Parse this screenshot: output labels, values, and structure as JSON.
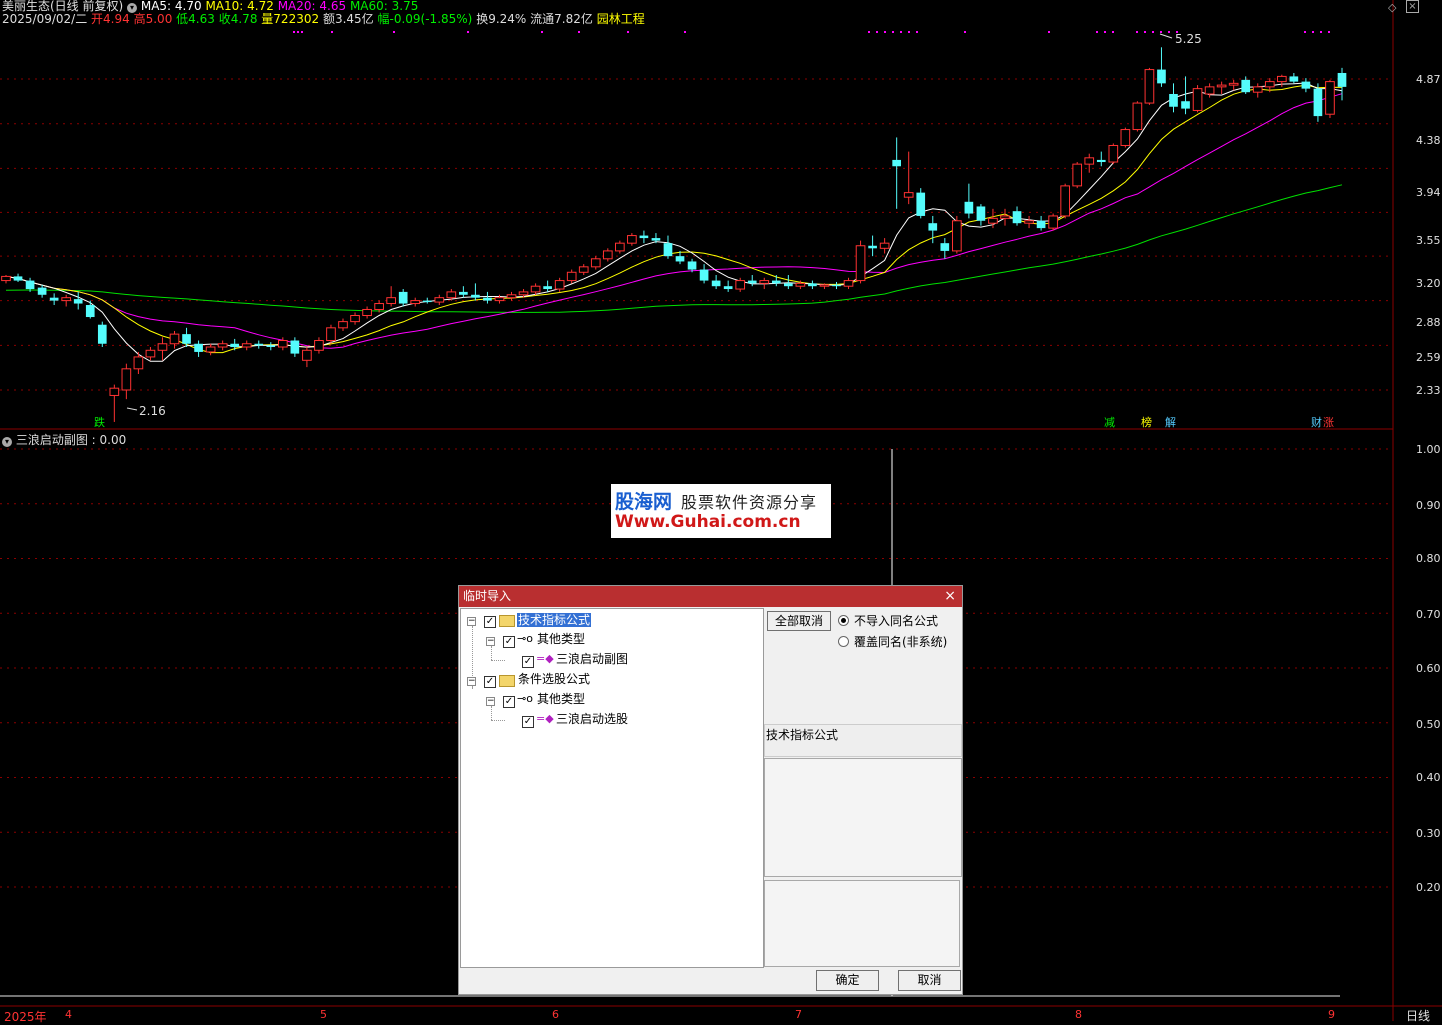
{
  "chart_header": {
    "stock": "美丽生态(日线 前复权)",
    "ma5": "MA5: 4.70",
    "ma10": "MA10: 4.72",
    "ma20": "MA20: 4.65",
    "ma60": "MA60: 3.75",
    "date": "2025/09/02/二",
    "open": "开4.94",
    "high": "高5.00",
    "low": "低4.63",
    "close": "收4.78",
    "volume": "量722302",
    "amount": "额3.45亿",
    "change": "幅-0.09(-1.85%)",
    "turnover": "换9.24%",
    "float_cap": "流通7.82亿",
    "sector": "园林工程"
  },
  "colors": {
    "up": "#ff3232",
    "down": "#54fcfc",
    "ma5": "#ffffff",
    "ma10": "#ffff00",
    "ma20": "#ff00ff",
    "ma60": "#00e000",
    "grid": "#8b0000"
  },
  "price_axis": [
    "4.87",
    "4.38",
    "3.94",
    "3.55",
    "3.20",
    "2.88",
    "2.59",
    "2.33"
  ],
  "indicator_axis": [
    "1.00",
    "0.90",
    "0.80",
    "0.70",
    "0.60",
    "0.50",
    "0.40",
    "0.30",
    "0.20"
  ],
  "time_axis": [
    "2025年",
    "4",
    "5",
    "6",
    "7",
    "8",
    "9"
  ],
  "period_label": "日线",
  "annotations": {
    "high_mark": "5.25",
    "low_mark": "2.16"
  },
  "event_marks": [
    "跌",
    "减",
    "榜",
    "解",
    "财",
    "涨"
  ],
  "sub_chart": {
    "title": "三浪启动副图 : 0.00"
  },
  "watermark": {
    "brand": "股海网",
    "slogan": "股票软件资源分享",
    "url": "Www.Guhai.com.cn"
  },
  "dialog": {
    "title": "临时导入",
    "close_icon": "×",
    "tree": [
      {
        "label": "技术指标公式"
      },
      {
        "label": "其他类型"
      },
      {
        "label": "三浪启动副图"
      },
      {
        "label": "条件选股公式"
      },
      {
        "label": "其他类型"
      },
      {
        "label": "三浪启动选股"
      }
    ],
    "btn_uncheck_all": "全部取消",
    "radio_no_import": "不导入同名公式",
    "radio_overwrite": "覆盖同名(非系统)",
    "info_label": "技术指标公式",
    "btn_ok": "确定",
    "btn_cancel": "取消"
  },
  "chart_data": {
    "type": "candlestick",
    "ylim": [
      2.16,
      5.25
    ],
    "candles": [
      [
        3.02,
        3.06,
        3.0,
        3.05
      ],
      [
        3.05,
        3.07,
        3.01,
        3.02
      ],
      [
        3.02,
        3.04,
        2.94,
        2.96
      ],
      [
        2.97,
        2.99,
        2.9,
        2.92
      ],
      [
        2.9,
        2.93,
        2.85,
        2.88
      ],
      [
        2.88,
        2.92,
        2.84,
        2.9
      ],
      [
        2.89,
        2.94,
        2.82,
        2.86
      ],
      [
        2.85,
        2.88,
        2.76,
        2.77
      ],
      [
        2.72,
        2.74,
        2.58,
        2.6
      ],
      [
        2.3,
        2.36,
        2.16,
        2.34
      ],
      [
        2.33,
        2.48,
        2.28,
        2.45
      ],
      [
        2.45,
        2.55,
        2.42,
        2.52
      ],
      [
        2.52,
        2.58,
        2.5,
        2.56
      ],
      [
        2.56,
        2.64,
        2.5,
        2.6
      ],
      [
        2.6,
        2.68,
        2.57,
        2.66
      ],
      [
        2.66,
        2.7,
        2.58,
        2.6
      ],
      [
        2.6,
        2.62,
        2.52,
        2.55
      ],
      [
        2.55,
        2.6,
        2.53,
        2.58
      ],
      [
        2.58,
        2.62,
        2.56,
        2.6
      ],
      [
        2.6,
        2.63,
        2.56,
        2.58
      ],
      [
        2.58,
        2.62,
        2.56,
        2.6
      ],
      [
        2.6,
        2.62,
        2.57,
        2.59
      ],
      [
        2.59,
        2.61,
        2.56,
        2.58
      ],
      [
        2.58,
        2.64,
        2.56,
        2.62
      ],
      [
        2.62,
        2.64,
        2.52,
        2.54
      ],
      [
        2.5,
        2.58,
        2.46,
        2.56
      ],
      [
        2.56,
        2.64,
        2.54,
        2.62
      ],
      [
        2.62,
        2.72,
        2.6,
        2.7
      ],
      [
        2.7,
        2.76,
        2.68,
        2.74
      ],
      [
        2.74,
        2.8,
        2.72,
        2.78
      ],
      [
        2.78,
        2.84,
        2.76,
        2.82
      ],
      [
        2.82,
        2.88,
        2.8,
        2.86
      ],
      [
        2.86,
        2.98,
        2.84,
        2.9
      ],
      [
        2.94,
        2.96,
        2.84,
        2.86
      ],
      [
        2.86,
        2.9,
        2.84,
        2.88
      ],
      [
        2.88,
        2.9,
        2.86,
        2.87
      ],
      [
        2.87,
        2.92,
        2.85,
        2.9
      ],
      [
        2.9,
        2.96,
        2.88,
        2.94
      ],
      [
        2.94,
        2.98,
        2.9,
        2.92
      ],
      [
        2.92,
        3.0,
        2.88,
        2.9
      ],
      [
        2.9,
        2.94,
        2.86,
        2.88
      ],
      [
        2.88,
        2.92,
        2.86,
        2.9
      ],
      [
        2.9,
        2.94,
        2.88,
        2.92
      ],
      [
        2.92,
        2.96,
        2.9,
        2.94
      ],
      [
        2.94,
        3.0,
        2.92,
        2.98
      ],
      [
        2.98,
        3.02,
        2.94,
        2.96
      ],
      [
        2.96,
        3.04,
        2.94,
        3.02
      ],
      [
        3.02,
        3.1,
        3.0,
        3.08
      ],
      [
        3.08,
        3.14,
        3.06,
        3.12
      ],
      [
        3.12,
        3.2,
        3.1,
        3.18
      ],
      [
        3.18,
        3.26,
        3.16,
        3.24
      ],
      [
        3.24,
        3.32,
        3.22,
        3.3
      ],
      [
        3.3,
        3.38,
        3.28,
        3.36
      ],
      [
        3.36,
        3.4,
        3.3,
        3.34
      ],
      [
        3.34,
        3.38,
        3.3,
        3.32
      ],
      [
        3.3,
        3.36,
        3.18,
        3.2
      ],
      [
        3.2,
        3.24,
        3.14,
        3.16
      ],
      [
        3.16,
        3.18,
        3.08,
        3.1
      ],
      [
        3.1,
        3.14,
        3.0,
        3.02
      ],
      [
        3.02,
        3.06,
        2.96,
        2.98
      ],
      [
        2.98,
        3.02,
        2.94,
        2.96
      ],
      [
        2.96,
        3.04,
        2.94,
        3.02
      ],
      [
        3.02,
        3.06,
        2.98,
        3.0
      ],
      [
        3.0,
        3.04,
        2.96,
        3.02
      ],
      [
        3.02,
        3.06,
        2.98,
        3.0
      ],
      [
        3.0,
        3.06,
        2.96,
        2.98
      ],
      [
        2.98,
        3.02,
        2.96,
        3.0
      ],
      [
        3.0,
        3.02,
        2.96,
        2.98
      ],
      [
        2.98,
        3.0,
        2.96,
        2.99
      ],
      [
        2.99,
        3.01,
        2.96,
        2.98
      ],
      [
        2.98,
        3.04,
        2.96,
        3.02
      ],
      [
        3.02,
        3.32,
        3.0,
        3.28
      ],
      [
        3.28,
        3.36,
        3.2,
        3.26
      ],
      [
        3.26,
        3.34,
        3.22,
        3.3
      ],
      [
        4.02,
        4.24,
        3.58,
        3.96
      ],
      [
        3.68,
        4.1,
        3.62,
        3.72
      ],
      [
        3.72,
        3.76,
        3.5,
        3.52
      ],
      [
        3.46,
        3.52,
        3.3,
        3.4
      ],
      [
        3.3,
        3.34,
        3.18,
        3.24
      ],
      [
        3.24,
        3.52,
        3.22,
        3.48
      ],
      [
        3.64,
        3.8,
        3.5,
        3.54
      ],
      [
        3.6,
        3.62,
        3.44,
        3.48
      ],
      [
        3.46,
        3.58,
        3.42,
        3.5
      ],
      [
        3.5,
        3.58,
        3.44,
        3.52
      ],
      [
        3.56,
        3.6,
        3.44,
        3.46
      ],
      [
        3.46,
        3.52,
        3.42,
        3.48
      ],
      [
        3.48,
        3.52,
        3.4,
        3.42
      ],
      [
        3.42,
        3.54,
        3.4,
        3.52
      ],
      [
        3.52,
        3.8,
        3.5,
        3.78
      ],
      [
        3.78,
        4.0,
        3.76,
        3.98
      ],
      [
        3.98,
        4.08,
        3.9,
        4.04
      ],
      [
        4.02,
        4.1,
        3.96,
        4.0
      ],
      [
        4.0,
        4.18,
        3.98,
        4.16
      ],
      [
        4.16,
        4.34,
        4.14,
        4.32
      ],
      [
        4.32,
        4.62,
        4.3,
        4.6
      ],
      [
        4.6,
        5.0,
        4.58,
        4.98
      ],
      [
        4.98,
        5.25,
        4.78,
        4.82
      ],
      [
        4.7,
        4.82,
        4.5,
        4.56
      ],
      [
        4.62,
        4.9,
        4.48,
        4.54
      ],
      [
        4.52,
        4.8,
        4.5,
        4.76
      ],
      [
        4.7,
        4.82,
        4.66,
        4.78
      ],
      [
        4.78,
        4.84,
        4.7,
        4.8
      ],
      [
        4.8,
        4.86,
        4.74,
        4.82
      ],
      [
        4.86,
        4.9,
        4.7,
        4.72
      ],
      [
        4.72,
        4.82,
        4.66,
        4.78
      ],
      [
        4.78,
        4.88,
        4.72,
        4.84
      ],
      [
        4.84,
        4.92,
        4.78,
        4.9
      ],
      [
        4.9,
        4.94,
        4.82,
        4.84
      ],
      [
        4.84,
        4.88,
        4.72,
        4.76
      ],
      [
        4.76,
        4.82,
        4.4,
        4.46
      ],
      [
        4.48,
        4.86,
        4.44,
        4.84
      ],
      [
        4.94,
        5.0,
        4.63,
        4.78
      ]
    ],
    "indicator_spike": {
      "value": 1.0
    }
  }
}
